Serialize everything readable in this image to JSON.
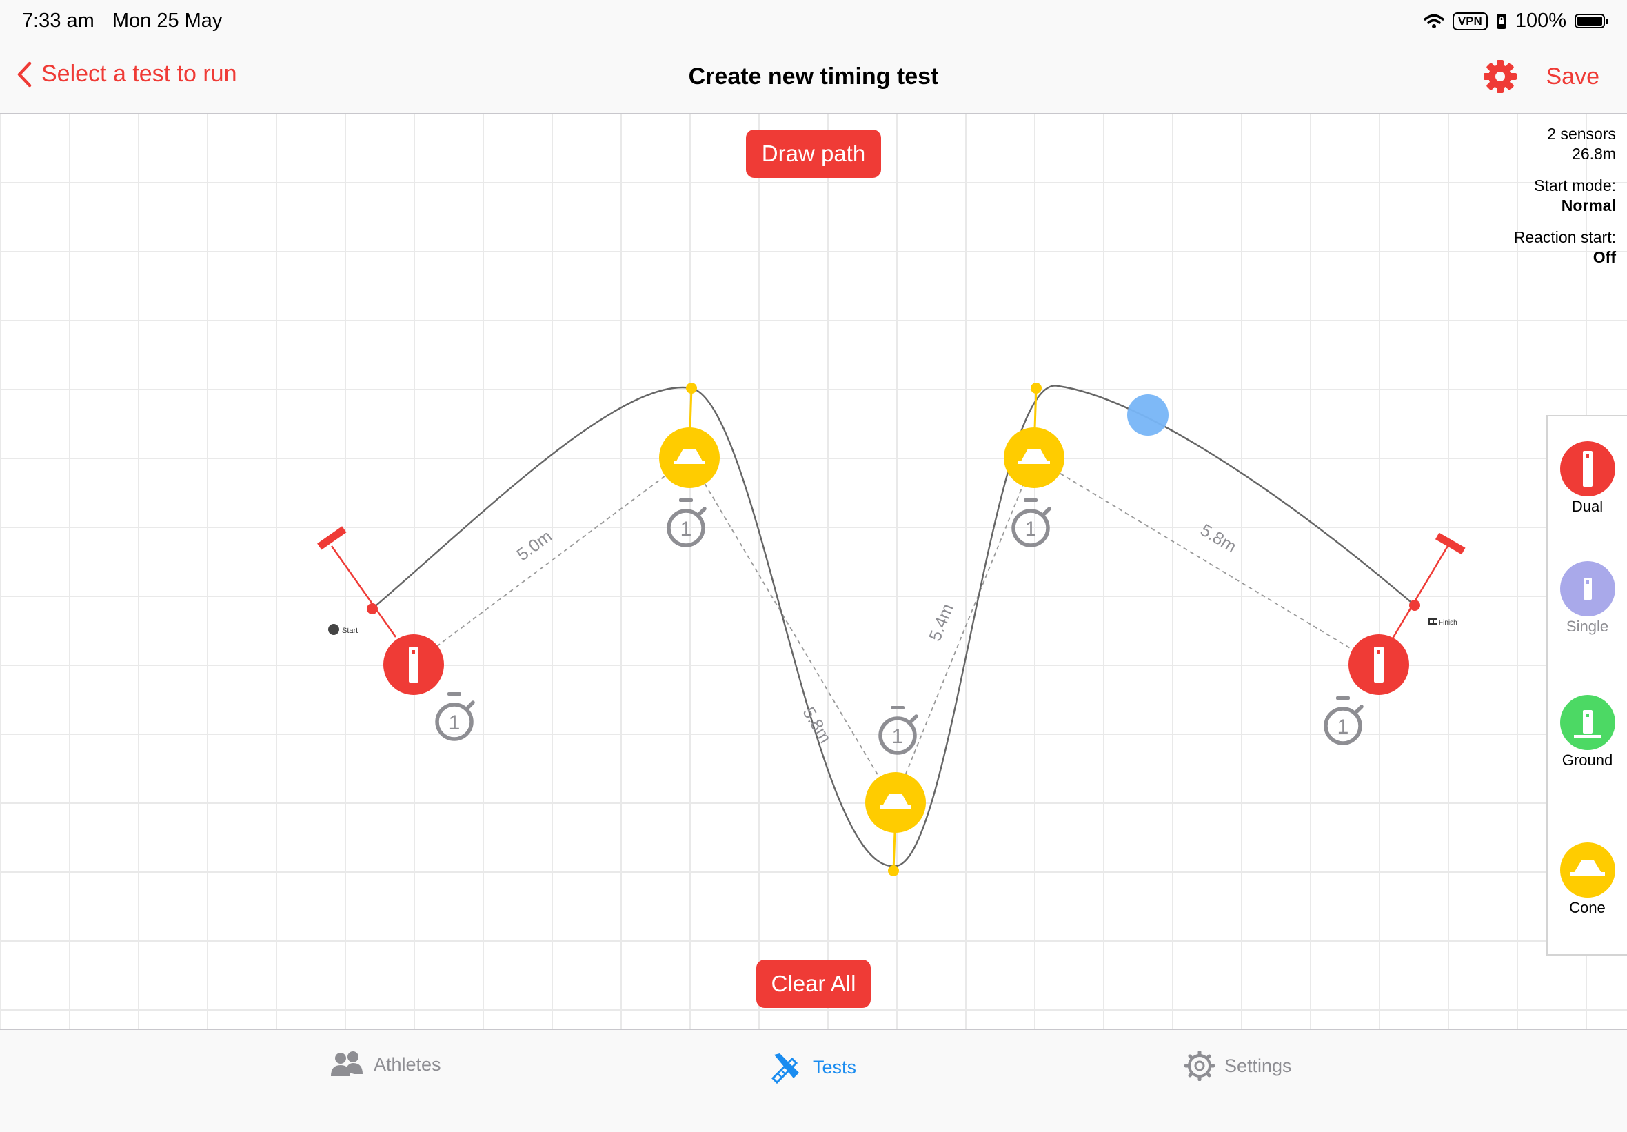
{
  "status_bar": {
    "time": "7:33 am",
    "date": "Mon 25 May",
    "vpn": "VPN",
    "battery": "100%"
  },
  "nav": {
    "back_label": "Select a test to run",
    "title": "Create new timing test",
    "save_label": "Save"
  },
  "canvas": {
    "draw_path_label": "Draw path",
    "clear_all_label": "Clear All",
    "info": {
      "sensors": "2 sensors",
      "distance": "26.8m",
      "start_mode_label": "Start mode:",
      "start_mode_value": "Normal",
      "reaction_start_label": "Reaction start:",
      "reaction_start_value": "Off"
    },
    "start_label": "Start",
    "finish_label": "Finish",
    "segments": [
      "5.0m",
      "5.8m",
      "5.4m",
      "5.8m"
    ],
    "timer_numbers": [
      "1",
      "1",
      "1",
      "1",
      "1"
    ]
  },
  "palette": {
    "items": [
      {
        "label": "Dual",
        "color": "#ef3b36"
      },
      {
        "label": "Single",
        "color": "#a9a9ea"
      },
      {
        "label": "Ground",
        "color": "#4cd964"
      },
      {
        "label": "Cone",
        "color": "#ffcc00"
      }
    ]
  },
  "tab_bar": {
    "athletes": "Athletes",
    "tests": "Tests",
    "settings": "Settings"
  },
  "colors": {
    "accent": "#ef3b36",
    "cone": "#ffcc00",
    "tab_active": "#1a8cf0",
    "path_marker": "#77b5f7"
  }
}
